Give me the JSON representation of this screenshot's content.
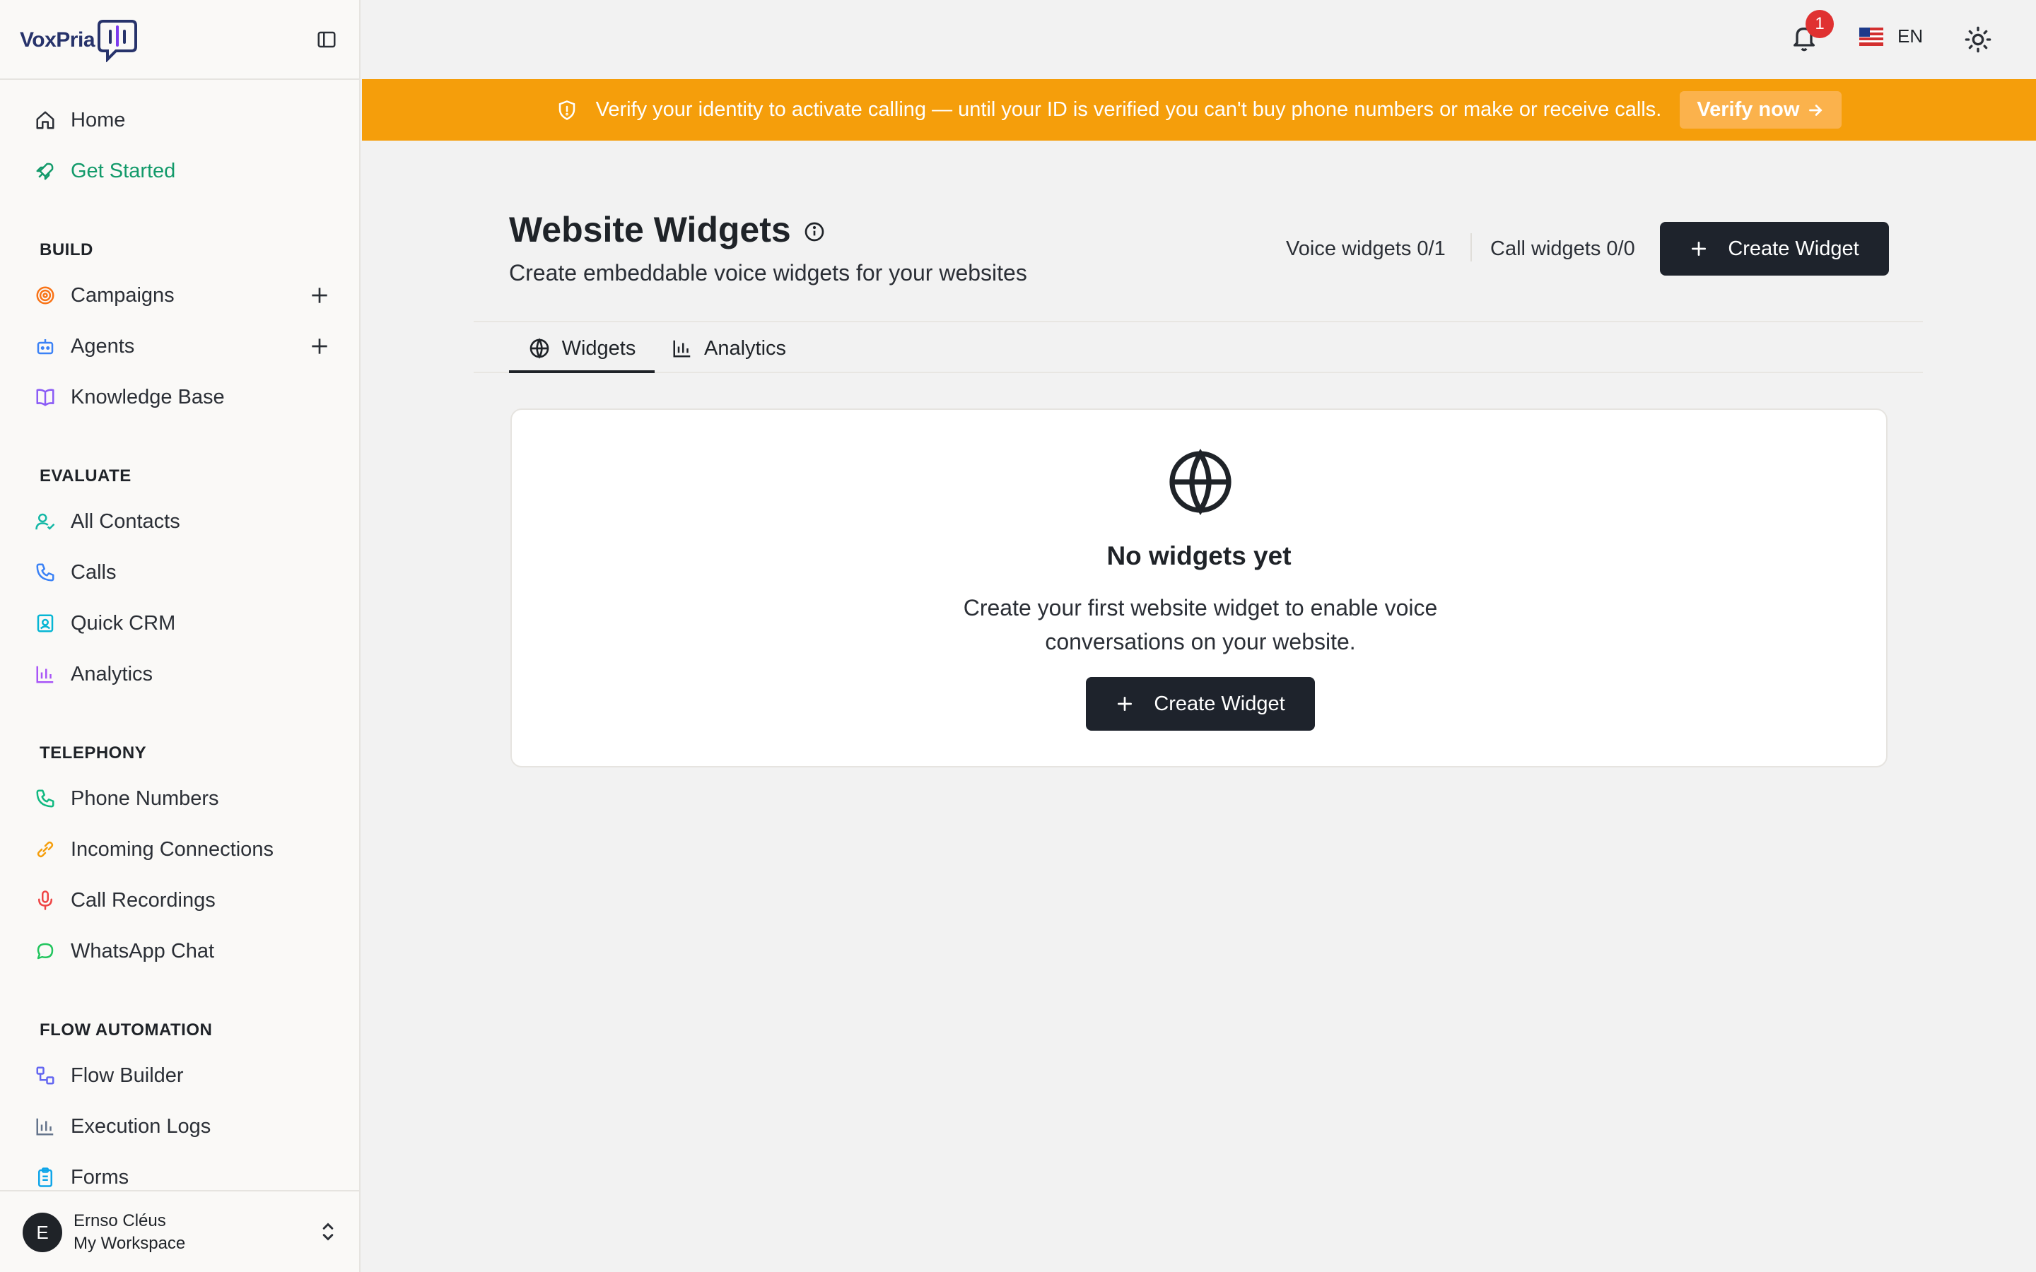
{
  "brand": {
    "name": "VoxPria"
  },
  "sidebar": {
    "primary": [
      {
        "label": "Home",
        "icon": "home-icon"
      },
      {
        "label": "Get Started",
        "icon": "rocket-icon",
        "active": true
      }
    ],
    "sections": [
      {
        "title": "BUILD",
        "items": [
          {
            "label": "Campaigns",
            "icon": "target-icon"
          },
          {
            "label": "Agents",
            "icon": "bot-icon"
          },
          {
            "label": "Knowledge Base",
            "icon": "book-icon"
          }
        ]
      },
      {
        "title": "EVALUATE",
        "items": [
          {
            "label": "All Contacts",
            "icon": "user-check-icon"
          },
          {
            "label": "Calls",
            "icon": "phone-icon"
          },
          {
            "label": "Quick CRM",
            "icon": "contact-card-icon"
          },
          {
            "label": "Analytics",
            "icon": "bar-chart-icon"
          }
        ]
      },
      {
        "title": "TELEPHONY",
        "items": [
          {
            "label": "Phone Numbers",
            "icon": "phone-icon"
          },
          {
            "label": "Incoming Connections",
            "icon": "link-icon"
          },
          {
            "label": "Call Recordings",
            "icon": "mic-icon"
          },
          {
            "label": "WhatsApp Chat",
            "icon": "message-circle-icon"
          }
        ]
      },
      {
        "title": "FLOW AUTOMATION",
        "items": [
          {
            "label": "Flow Builder",
            "icon": "workflow-icon"
          },
          {
            "label": "Execution Logs",
            "icon": "bar-chart-icon"
          },
          {
            "label": "Forms",
            "icon": "clipboard-icon"
          }
        ]
      }
    ]
  },
  "user": {
    "initial": "E",
    "name": "Ernso Cléus",
    "workspace": "My Workspace"
  },
  "topbar": {
    "notification_count": "1",
    "language": "EN"
  },
  "banner": {
    "message": "Verify your identity to activate calling — until your ID is verified you can't buy phone numbers or make or receive calls.",
    "action_label": "Verify now"
  },
  "page": {
    "title": "Website Widgets",
    "subtitle": "Create embeddable voice widgets for your websites",
    "voice_widgets": "Voice widgets 0/1",
    "call_widgets": "Call widgets 0/0",
    "create_label": "Create Widget"
  },
  "tabs": [
    {
      "label": "Widgets",
      "icon": "globe-icon",
      "active": true
    },
    {
      "label": "Analytics",
      "icon": "bar-chart-icon"
    }
  ],
  "empty_state": {
    "title": "No widgets yet",
    "description": "Create your first website widget to enable voice conversations on your website.",
    "create_label": "Create Widget"
  },
  "colors": {
    "accent_green": "#129a6a",
    "banner_orange": "#f59e0b",
    "primary_dark": "#1e232c",
    "badge_red": "#e03131"
  }
}
